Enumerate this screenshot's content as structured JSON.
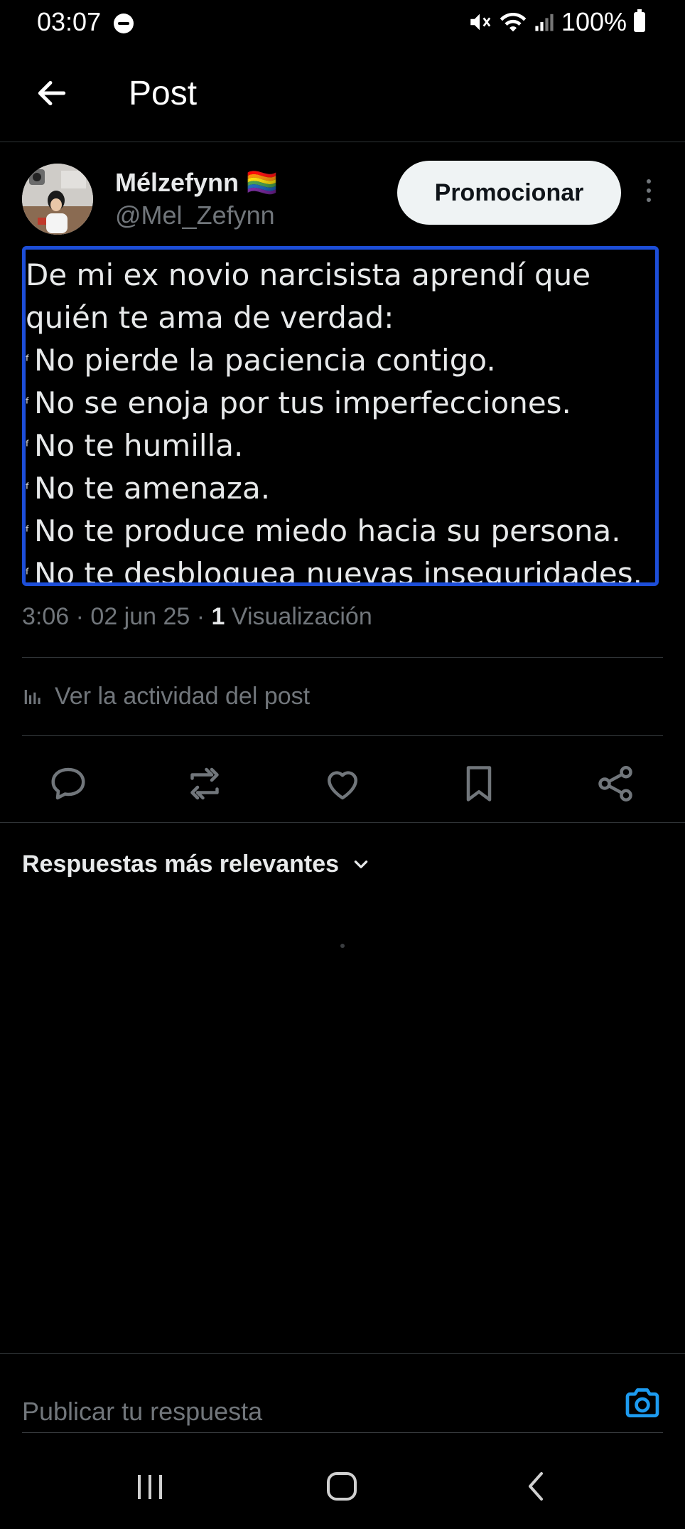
{
  "status_bar": {
    "time": "03:07",
    "battery": "100%"
  },
  "header": {
    "title": "Post"
  },
  "author": {
    "name": "Mélzefynn 🏳️‍🌈",
    "handle": "@Mel_Zefynn",
    "promote_label": "Promocionar"
  },
  "tweet": {
    "lines": [
      "De mi ex novio narcisista aprendí que",
      "quién te ama de verdad:",
      "No pierde la paciencia contigo.",
      "No se enoja por tus imperfecciones.",
      "No te humilla.",
      "No te amenaza.",
      "No te produce miedo hacia su persona.",
      "No te desbloquea nuevas inseguridades."
    ],
    "bullet": "ᶠ"
  },
  "meta": {
    "time": "3:06",
    "date": "02 jun 25",
    "views_count": "1",
    "views_label": "Visualización"
  },
  "activity_label": "Ver la actividad del post",
  "replies": {
    "sort_label": "Respuestas más relevantes"
  },
  "reply_box": {
    "placeholder": "Publicar tu respuesta"
  },
  "colors": {
    "accent": "#1d9bf0",
    "highlight_box": "#1d4ed8",
    "muted": "#71767b"
  }
}
